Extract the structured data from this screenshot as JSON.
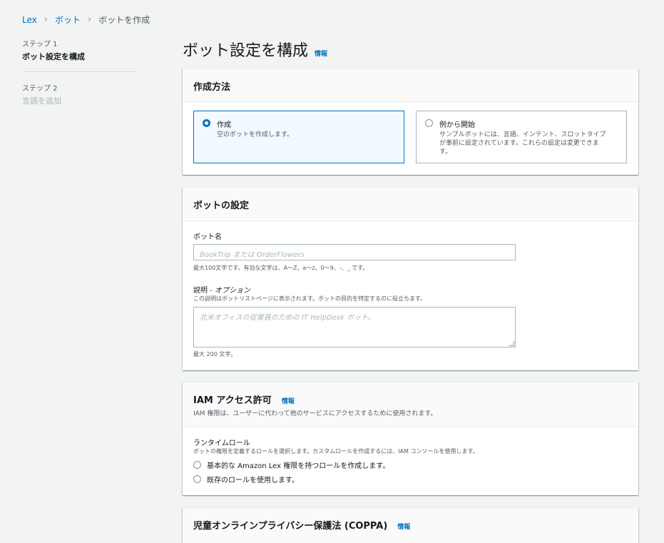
{
  "breadcrumb": {
    "items": [
      "Lex",
      "ボット"
    ],
    "current": "ボットを作成"
  },
  "steps": [
    {
      "label": "ステップ 1",
      "title": "ボット設定を構成"
    },
    {
      "label": "ステップ 2",
      "title": "言語を追加"
    }
  ],
  "page": {
    "title": "ボット設定を構成",
    "info": "情報"
  },
  "creation": {
    "title": "作成方法",
    "options": [
      {
        "title": "作成",
        "desc": "空のボットを作成します。",
        "selected": true
      },
      {
        "title": "例から開始",
        "desc_lines": [
          "サンプルボットには、言語、インテント、スロットタイプ",
          "が事前に設定されています。これらの設定は変更できま",
          "す。"
        ],
        "selected": false
      }
    ]
  },
  "bot_settings": {
    "title": "ボットの設定",
    "name_label": "ボット名",
    "name_placeholder": "BookTrip または OrderFlowers",
    "name_hint": "最大100文字です。有効な文字は、A〜Z、a〜z、0〜9、-、_ です。",
    "desc_label": "説明",
    "desc_optional": " - オプション",
    "desc_sub": "この説明はボットリストページに表示されます。ボットの目的を特定するのに役立ちます。",
    "desc_placeholder": "北米オフィスの従業員のための IT HelpDesk ボット。",
    "desc_hint": "最大 200 文字。"
  },
  "iam": {
    "title": "IAM アクセス許可",
    "info": "情報",
    "sub": "IAM 権限は、ユーザーに代わって他のサービスにアクセスするために使用されます。",
    "role_label": "ランタイムロール",
    "role_sub": "ボットの権限を定義するロールを選択します。カスタムロールを作成するには、IAM コンソールを使用します。",
    "options": [
      "基本的な Amazon Lex 権限を持つロールを作成します。",
      "既存のロールを使用します。"
    ]
  },
  "coppa": {
    "title": "児童オンラインプライバシー保護法 (COPPA)",
    "info": "情報"
  },
  "colors": {
    "accent": "#0073bb",
    "background": "#f2f3f3"
  }
}
